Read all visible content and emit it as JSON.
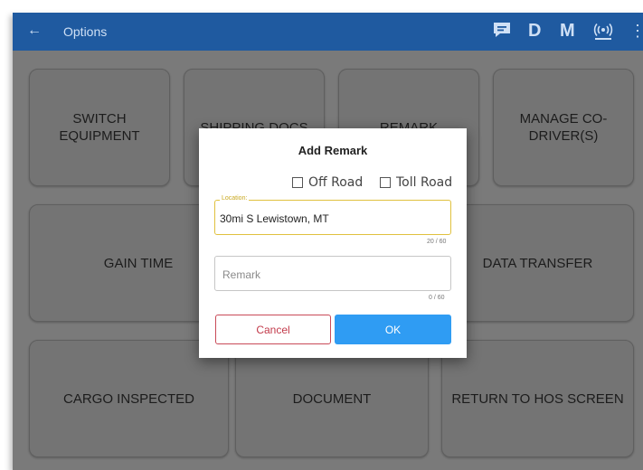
{
  "appbar": {
    "back_icon": "arrow-back-icon",
    "title": "Options",
    "action_d": "D",
    "action_m": "M",
    "icons": [
      "message-icon",
      "antenna-icon",
      "more-vert-icon"
    ]
  },
  "tiles": [
    "SWITCH EQUIPMENT",
    "SHIPPING DOCS",
    "REMARK",
    "MANAGE CO-DRIVER(S)",
    "GAIN TIME",
    "DATA TRANSFER",
    "CARGO INSPECTED",
    "DOCUMENT",
    "RETURN TO HOS SCREEN"
  ],
  "dialog": {
    "title": "Add Remark",
    "checkbox_off_road": "Off Road",
    "checkbox_toll_road": "Toll Road",
    "location_label": "Location:",
    "location_value": "30mi S Lewistown, MT",
    "location_counter": "20 / 60",
    "remark_placeholder": "Remark",
    "remark_counter": "0 / 60",
    "cancel_label": "Cancel",
    "ok_label": "OK"
  },
  "colors": {
    "appbar": "#1f5aa0",
    "overlay": "#7a7a7a",
    "ok_button": "#2f9cf3",
    "cancel_border": "#c94a58",
    "location_focus": "#e0c13e"
  }
}
